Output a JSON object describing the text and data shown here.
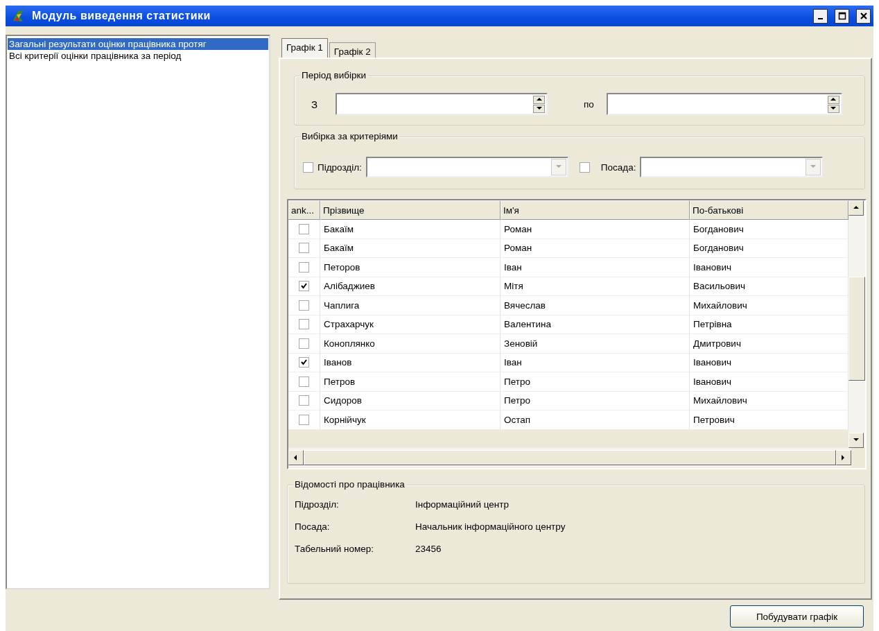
{
  "window": {
    "title": "Модуль виведення статистики"
  },
  "sidebar": {
    "items": [
      {
        "label": "Загальні результати оцінки працівника протяг",
        "selected": true
      },
      {
        "label": "Всі критерії оцінки працівника за період",
        "selected": false
      }
    ]
  },
  "tabs": [
    {
      "label": "Графік 1",
      "selected": true
    },
    {
      "label": "Графік 2",
      "selected": false
    }
  ],
  "period": {
    "title": "Період вибірки",
    "from_label": "З",
    "to_label": "по"
  },
  "criteria": {
    "title": "Вибірка за критеріями",
    "filters": [
      {
        "label": "Підрозділ:",
        "checked": false
      },
      {
        "label": "Посада:",
        "checked": false
      }
    ]
  },
  "table": {
    "columns": [
      "ank...",
      "Прізвище",
      "Ім'я",
      "По-батькові"
    ],
    "rows": [
      {
        "checked": false,
        "cells": [
          "",
          "Бакаїм",
          "Роман",
          "Богданович"
        ]
      },
      {
        "checked": false,
        "cells": [
          "",
          "Бакаїм",
          "Роман",
          "Богданович"
        ]
      },
      {
        "checked": false,
        "cells": [
          "",
          "Петоров",
          "Іван",
          "Іванович"
        ]
      },
      {
        "checked": true,
        "cells": [
          "",
          "Алібаджиев",
          "Мітя",
          "Васильович"
        ]
      },
      {
        "checked": false,
        "cells": [
          "",
          "Чаплига",
          "Вячеслав",
          "Михайлович"
        ]
      },
      {
        "checked": false,
        "cells": [
          "",
          "Страхарчук",
          "Валентина",
          "Петрівна"
        ]
      },
      {
        "checked": false,
        "cells": [
          "",
          "Коноплянко",
          "Зеновій",
          "Дмитрович"
        ]
      },
      {
        "checked": true,
        "cells": [
          "",
          "Іванов",
          "Іван",
          "Іванович"
        ]
      },
      {
        "checked": false,
        "cells": [
          "",
          "Петров",
          "Петро",
          "Іванович"
        ]
      },
      {
        "checked": false,
        "cells": [
          "",
          "Сидоров",
          "Петро",
          "Михайлович"
        ]
      },
      {
        "checked": false,
        "cells": [
          "",
          "Корнійчук",
          "Остап",
          "Петрович"
        ]
      }
    ]
  },
  "employee_info": {
    "title": "Відомості про працівника",
    "fields": [
      {
        "label": "Підрозділ:",
        "value": "Інформаційний центр"
      },
      {
        "label": "Посада:",
        "value": "Начальник інформаційного центру"
      },
      {
        "label": "Табельний номер:",
        "value": "23456"
      }
    ]
  },
  "buttons": [
    "Побудувати графік"
  ]
}
